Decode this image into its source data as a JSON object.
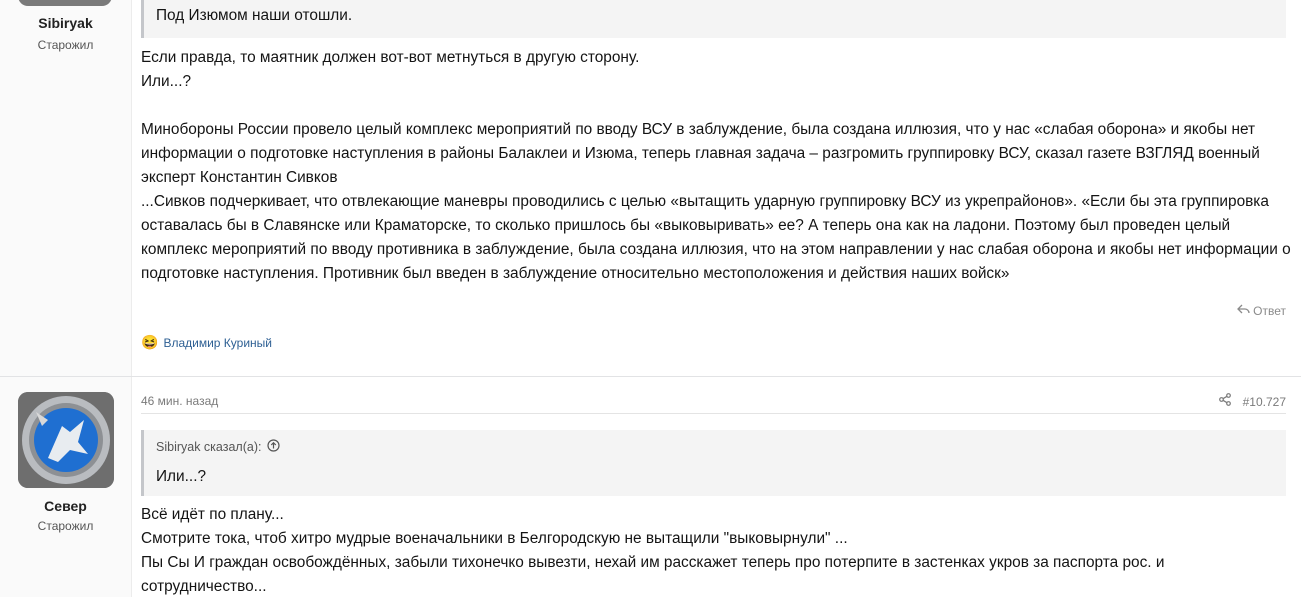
{
  "post1": {
    "username": "Sibiryak",
    "user_title": "Старожил",
    "quote_text": "Под Изюмом наши отошли.",
    "paragraphs": [
      "Если правда, то маятник должен вот-вот метнуться в другую сторону.\nИли...?",
      "Минобороны России провело целый комплекс мероприятий по вводу ВСУ в заблуждение, была создана иллюзия, что у нас «слабая оборона» и якобы нет информации о подготовке наступления в районы Балаклеи и Изюма, теперь главная задача – разгромить группировку ВСУ, сказал газете ВЗГЛЯД военный эксперт Константин Сивков\n...Сивков подчеркивает, что отвлекающие маневры проводились с целью «вытащить ударную группировку ВСУ из укрепрайонов». «Если бы эта группировка оставалась бы в Славянске или Краматорске, то сколько пришлось бы «выковыривать» ее? А теперь она как на ладони. Поэтому был проведен целый комплекс мероприятий по вводу противника в заблуждение, была создана иллюзия, что на этом направлении у нас слабая оборона и якобы нет информации о подготовке наступления. Противник был введен в заблуждение относительно местоположения и действия наших войск»"
    ],
    "reply_label": "Ответ",
    "reaction_user": "Владимир Куриный",
    "reaction_emoji": "😆"
  },
  "post2": {
    "username": "Север",
    "user_title": "Старожил",
    "timestamp": "46 мин. назад",
    "post_number": "#10.727",
    "quote_attribution": "Sibiryak сказал(а):",
    "quote_text": "Или...?",
    "body": "Всё идёт по плану...\nСмотрите тока, чтоб хитро мудрые военачальники в Белгородскую не вытащили \"выковырнули\" ...\nПы Сы И граждан освобождённых, забыли тихонечко вывезти, нехай им расскажет теперь про потерпите в застенках укров за паспорта рос. и сотрудничество..."
  },
  "colors": {
    "link": "#2d5f93",
    "quote_bg": "#f4f4f4",
    "quote_border": "#c4c6ca",
    "avatar_blue": "#1f6fd1"
  },
  "icons": [
    "reply-icon",
    "share-icon",
    "quote-jump-icon",
    "laugh-reaction-icon"
  ]
}
